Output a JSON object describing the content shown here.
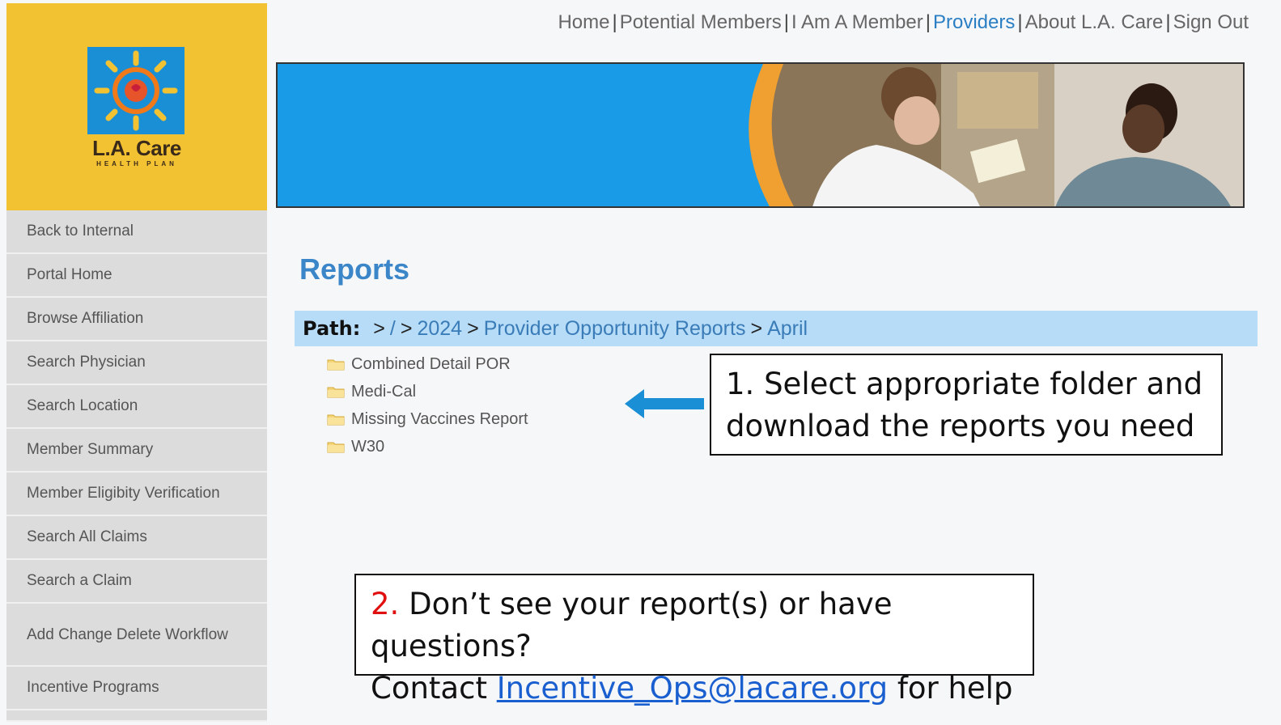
{
  "logo": {
    "name": "L.A. Care",
    "subtitle": "HEALTH PLAN"
  },
  "nav": [
    {
      "label": "Home",
      "active": false
    },
    {
      "label": "Potential Members",
      "active": false
    },
    {
      "label": "I Am A Member",
      "active": false
    },
    {
      "label": "Providers",
      "active": true
    },
    {
      "label": "About L.A. Care",
      "active": false
    },
    {
      "label": "Sign Out",
      "active": false
    }
  ],
  "sidebar": {
    "items": [
      {
        "label": "Back to Internal"
      },
      {
        "label": "Portal Home"
      },
      {
        "label": "Browse Affiliation"
      },
      {
        "label": "Search Physician"
      },
      {
        "label": "Search Location"
      },
      {
        "label": "Member Summary"
      },
      {
        "label": "Member Eligibity Verification"
      },
      {
        "label": "Search All Claims"
      },
      {
        "label": "Search a Claim"
      },
      {
        "label": "Add Change Delete Workflow"
      },
      {
        "label": "Incentive Programs"
      }
    ]
  },
  "page": {
    "title": "Reports"
  },
  "path": {
    "label": "Path:",
    "root": "/",
    "crumbs": [
      "2024",
      "Provider Opportunity Reports",
      "April"
    ]
  },
  "folders": [
    {
      "label": "Combined Detail POR"
    },
    {
      "label": "Medi-Cal"
    },
    {
      "label": "Missing Vaccines Report"
    },
    {
      "label": "W30"
    }
  ],
  "callouts": {
    "first": {
      "line1": "1. Select appropriate folder and",
      "line2": "download the reports you need"
    },
    "second": {
      "number": "2.",
      "line1": " Don’t see your report(s) or have questions?",
      "contact_prefix": "Contact ",
      "email": "Incentive_Ops@lacare.org",
      "contact_suffix": " for help"
    }
  },
  "colors": {
    "brand_yellow": "#f2c232",
    "link_blue": "#2a7fc4",
    "path_bg": "#b7dcf7",
    "banner_blue": "#1a9be8"
  }
}
